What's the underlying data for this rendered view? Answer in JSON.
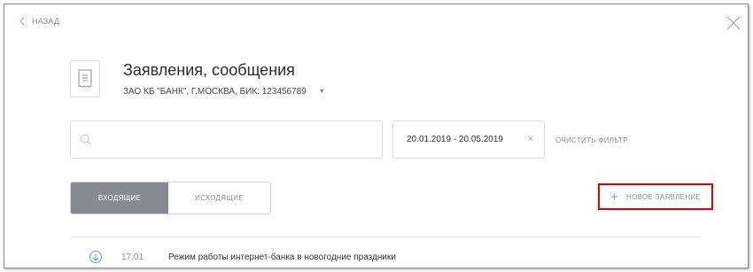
{
  "nav": {
    "back_label": "НАЗАД"
  },
  "header": {
    "title": "Заявления, сообщения",
    "organization": "ЗАО КБ \"БАНК\", Г.МОСКВА, БИК: 123456789"
  },
  "filters": {
    "search_value": "",
    "date_range": "20.01.2019 - 20.05.2019",
    "clear_filter_label": "ОЧИСТИТЬ ФИЛЬТР"
  },
  "tabs": [
    {
      "label": "ВХОДЯЩИЕ",
      "active": true
    },
    {
      "label": "ИСХОДЯЩИЕ",
      "active": false
    }
  ],
  "actions": {
    "new_statement_label": "НОВОЕ ЗАЯВЛЕНИЕ"
  },
  "messages": [
    {
      "date": "17.01",
      "text": "Режим работы интернет-банка в новогодние праздники",
      "direction_icon": "arrow-down-icon"
    }
  ],
  "colors": {
    "active_tab_bg": "#868b93",
    "highlight_border": "#e00000",
    "incoming_icon": "#4aa3df"
  }
}
